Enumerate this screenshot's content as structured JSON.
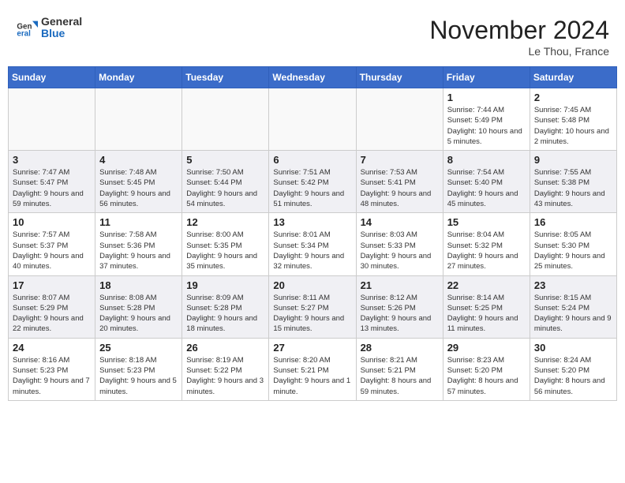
{
  "header": {
    "logo_general": "General",
    "logo_blue": "Blue",
    "month_title": "November 2024",
    "location": "Le Thou, France"
  },
  "weekdays": [
    "Sunday",
    "Monday",
    "Tuesday",
    "Wednesday",
    "Thursday",
    "Friday",
    "Saturday"
  ],
  "weeks": [
    [
      {
        "day": "",
        "info": ""
      },
      {
        "day": "",
        "info": ""
      },
      {
        "day": "",
        "info": ""
      },
      {
        "day": "",
        "info": ""
      },
      {
        "day": "",
        "info": ""
      },
      {
        "day": "1",
        "info": "Sunrise: 7:44 AM\nSunset: 5:49 PM\nDaylight: 10 hours and 5 minutes."
      },
      {
        "day": "2",
        "info": "Sunrise: 7:45 AM\nSunset: 5:48 PM\nDaylight: 10 hours and 2 minutes."
      }
    ],
    [
      {
        "day": "3",
        "info": "Sunrise: 7:47 AM\nSunset: 5:47 PM\nDaylight: 9 hours and 59 minutes."
      },
      {
        "day": "4",
        "info": "Sunrise: 7:48 AM\nSunset: 5:45 PM\nDaylight: 9 hours and 56 minutes."
      },
      {
        "day": "5",
        "info": "Sunrise: 7:50 AM\nSunset: 5:44 PM\nDaylight: 9 hours and 54 minutes."
      },
      {
        "day": "6",
        "info": "Sunrise: 7:51 AM\nSunset: 5:42 PM\nDaylight: 9 hours and 51 minutes."
      },
      {
        "day": "7",
        "info": "Sunrise: 7:53 AM\nSunset: 5:41 PM\nDaylight: 9 hours and 48 minutes."
      },
      {
        "day": "8",
        "info": "Sunrise: 7:54 AM\nSunset: 5:40 PM\nDaylight: 9 hours and 45 minutes."
      },
      {
        "day": "9",
        "info": "Sunrise: 7:55 AM\nSunset: 5:38 PM\nDaylight: 9 hours and 43 minutes."
      }
    ],
    [
      {
        "day": "10",
        "info": "Sunrise: 7:57 AM\nSunset: 5:37 PM\nDaylight: 9 hours and 40 minutes."
      },
      {
        "day": "11",
        "info": "Sunrise: 7:58 AM\nSunset: 5:36 PM\nDaylight: 9 hours and 37 minutes."
      },
      {
        "day": "12",
        "info": "Sunrise: 8:00 AM\nSunset: 5:35 PM\nDaylight: 9 hours and 35 minutes."
      },
      {
        "day": "13",
        "info": "Sunrise: 8:01 AM\nSunset: 5:34 PM\nDaylight: 9 hours and 32 minutes."
      },
      {
        "day": "14",
        "info": "Sunrise: 8:03 AM\nSunset: 5:33 PM\nDaylight: 9 hours and 30 minutes."
      },
      {
        "day": "15",
        "info": "Sunrise: 8:04 AM\nSunset: 5:32 PM\nDaylight: 9 hours and 27 minutes."
      },
      {
        "day": "16",
        "info": "Sunrise: 8:05 AM\nSunset: 5:30 PM\nDaylight: 9 hours and 25 minutes."
      }
    ],
    [
      {
        "day": "17",
        "info": "Sunrise: 8:07 AM\nSunset: 5:29 PM\nDaylight: 9 hours and 22 minutes."
      },
      {
        "day": "18",
        "info": "Sunrise: 8:08 AM\nSunset: 5:28 PM\nDaylight: 9 hours and 20 minutes."
      },
      {
        "day": "19",
        "info": "Sunrise: 8:09 AM\nSunset: 5:28 PM\nDaylight: 9 hours and 18 minutes."
      },
      {
        "day": "20",
        "info": "Sunrise: 8:11 AM\nSunset: 5:27 PM\nDaylight: 9 hours and 15 minutes."
      },
      {
        "day": "21",
        "info": "Sunrise: 8:12 AM\nSunset: 5:26 PM\nDaylight: 9 hours and 13 minutes."
      },
      {
        "day": "22",
        "info": "Sunrise: 8:14 AM\nSunset: 5:25 PM\nDaylight: 9 hours and 11 minutes."
      },
      {
        "day": "23",
        "info": "Sunrise: 8:15 AM\nSunset: 5:24 PM\nDaylight: 9 hours and 9 minutes."
      }
    ],
    [
      {
        "day": "24",
        "info": "Sunrise: 8:16 AM\nSunset: 5:23 PM\nDaylight: 9 hours and 7 minutes."
      },
      {
        "day": "25",
        "info": "Sunrise: 8:18 AM\nSunset: 5:23 PM\nDaylight: 9 hours and 5 minutes."
      },
      {
        "day": "26",
        "info": "Sunrise: 8:19 AM\nSunset: 5:22 PM\nDaylight: 9 hours and 3 minutes."
      },
      {
        "day": "27",
        "info": "Sunrise: 8:20 AM\nSunset: 5:21 PM\nDaylight: 9 hours and 1 minute."
      },
      {
        "day": "28",
        "info": "Sunrise: 8:21 AM\nSunset: 5:21 PM\nDaylight: 8 hours and 59 minutes."
      },
      {
        "day": "29",
        "info": "Sunrise: 8:23 AM\nSunset: 5:20 PM\nDaylight: 8 hours and 57 minutes."
      },
      {
        "day": "30",
        "info": "Sunrise: 8:24 AM\nSunset: 5:20 PM\nDaylight: 8 hours and 56 minutes."
      }
    ]
  ]
}
